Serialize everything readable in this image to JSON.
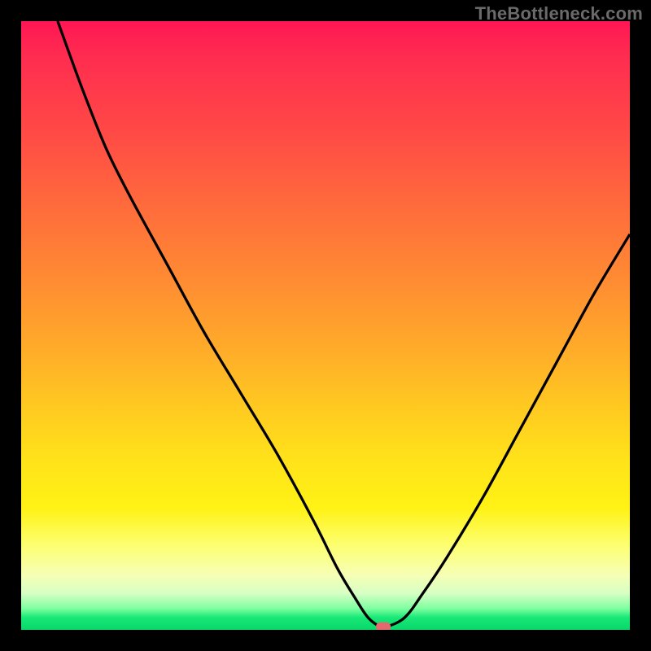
{
  "watermark": "TheBottleneck.com",
  "chart_data": {
    "type": "line",
    "title": "",
    "xlabel": "",
    "ylabel": "",
    "xlim": [
      0,
      100
    ],
    "ylim": [
      0,
      100
    ],
    "grid": false,
    "series": [
      {
        "name": "bottleneck-curve",
        "x": [
          6,
          10,
          14,
          18,
          24,
          30,
          36,
          42,
          48,
          52,
          55,
          57,
          59,
          60,
          63,
          66,
          70,
          76,
          82,
          88,
          94,
          100
        ],
        "values": [
          100,
          89,
          79,
          71,
          60,
          49,
          39,
          29,
          18,
          10,
          5,
          2,
          0.5,
          0.5,
          2,
          6,
          12,
          22,
          33,
          44,
          55,
          65
        ]
      }
    ],
    "marker": {
      "x": 59.5,
      "y": 0.5,
      "color": "#e46a6f"
    },
    "background_gradient": {
      "orientation": "vertical",
      "stops": [
        {
          "pos": 0.0,
          "color": "#ff1654"
        },
        {
          "pos": 0.3,
          "color": "#ff6a3c"
        },
        {
          "pos": 0.63,
          "color": "#ffc821"
        },
        {
          "pos": 0.86,
          "color": "#fdff6f"
        },
        {
          "pos": 0.98,
          "color": "#17e877"
        },
        {
          "pos": 1.0,
          "color": "#0ad76a"
        }
      ]
    }
  }
}
